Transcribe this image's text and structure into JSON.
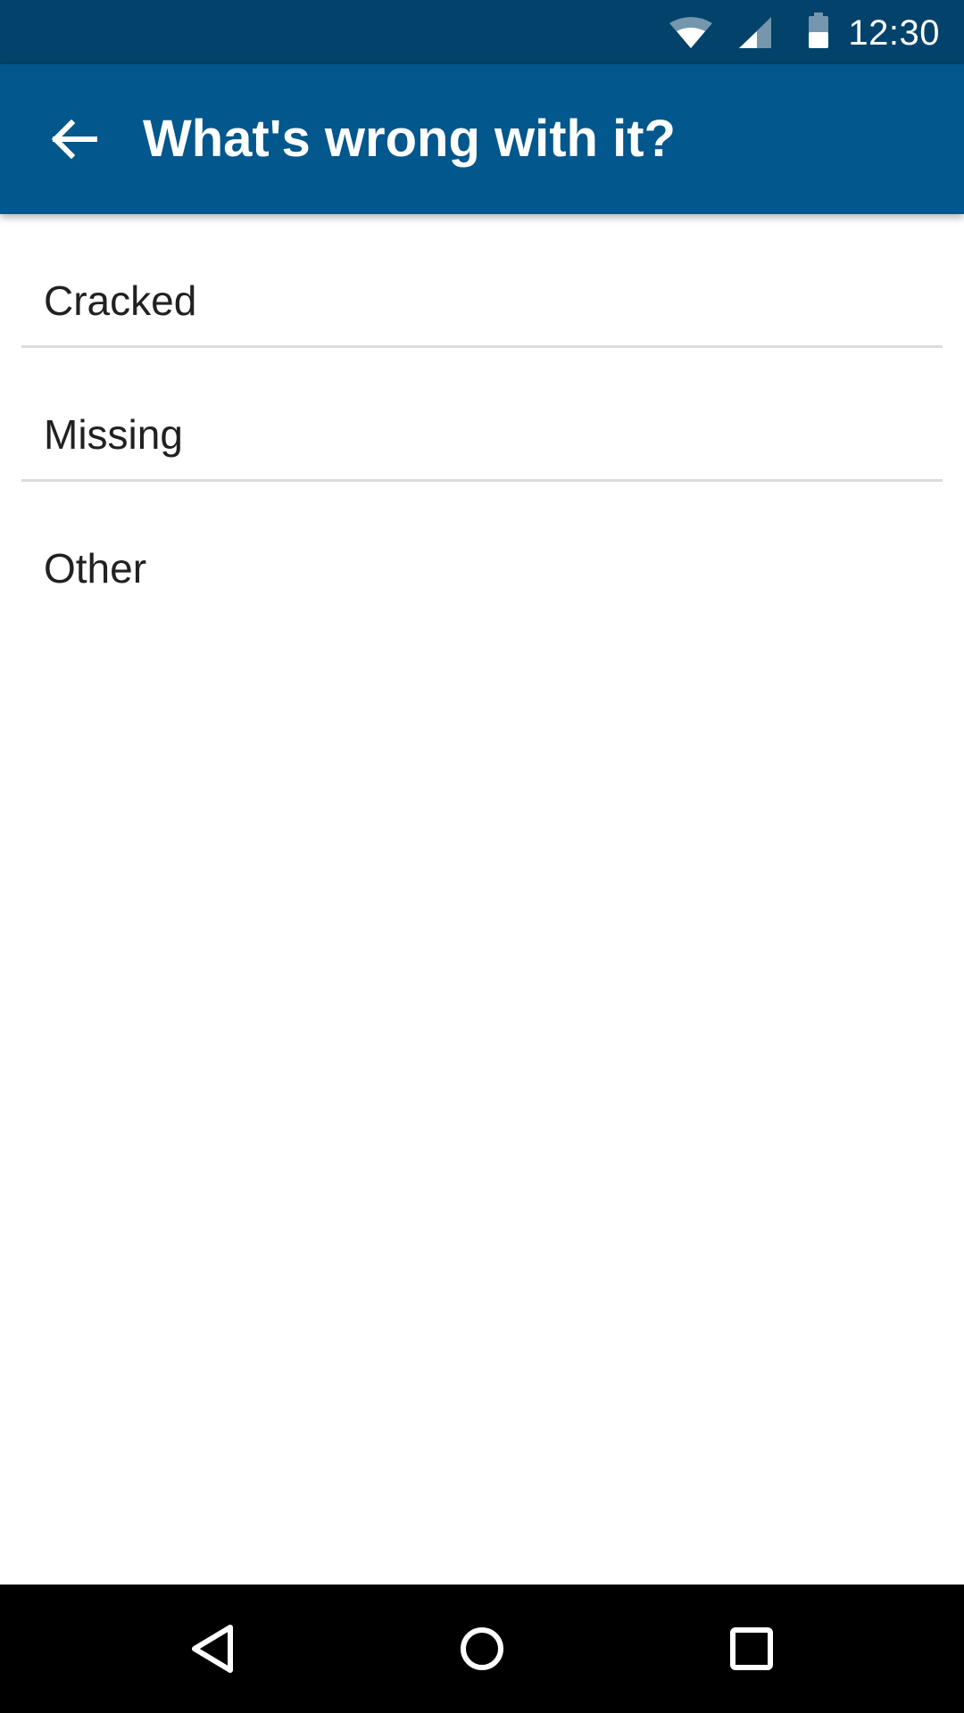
{
  "colors": {
    "status_bar": "#02426b",
    "app_bar": "#02578c",
    "title_text": "#ffffff",
    "list_text": "#212121",
    "divider": "#dcdcdc",
    "nav_bar": "#000000"
  },
  "status_bar": {
    "time": "12:30",
    "icons": [
      "wifi-icon",
      "cellular-signal-icon",
      "battery-icon"
    ]
  },
  "app_bar": {
    "back_icon": "arrow-back-icon",
    "title": "What's wrong with it?"
  },
  "list": {
    "items": [
      {
        "label": "Cracked"
      },
      {
        "label": "Missing"
      },
      {
        "label": "Other"
      }
    ]
  },
  "nav_bar": {
    "icons": [
      "back-triangle-icon",
      "home-circle-icon",
      "recents-square-icon"
    ]
  }
}
